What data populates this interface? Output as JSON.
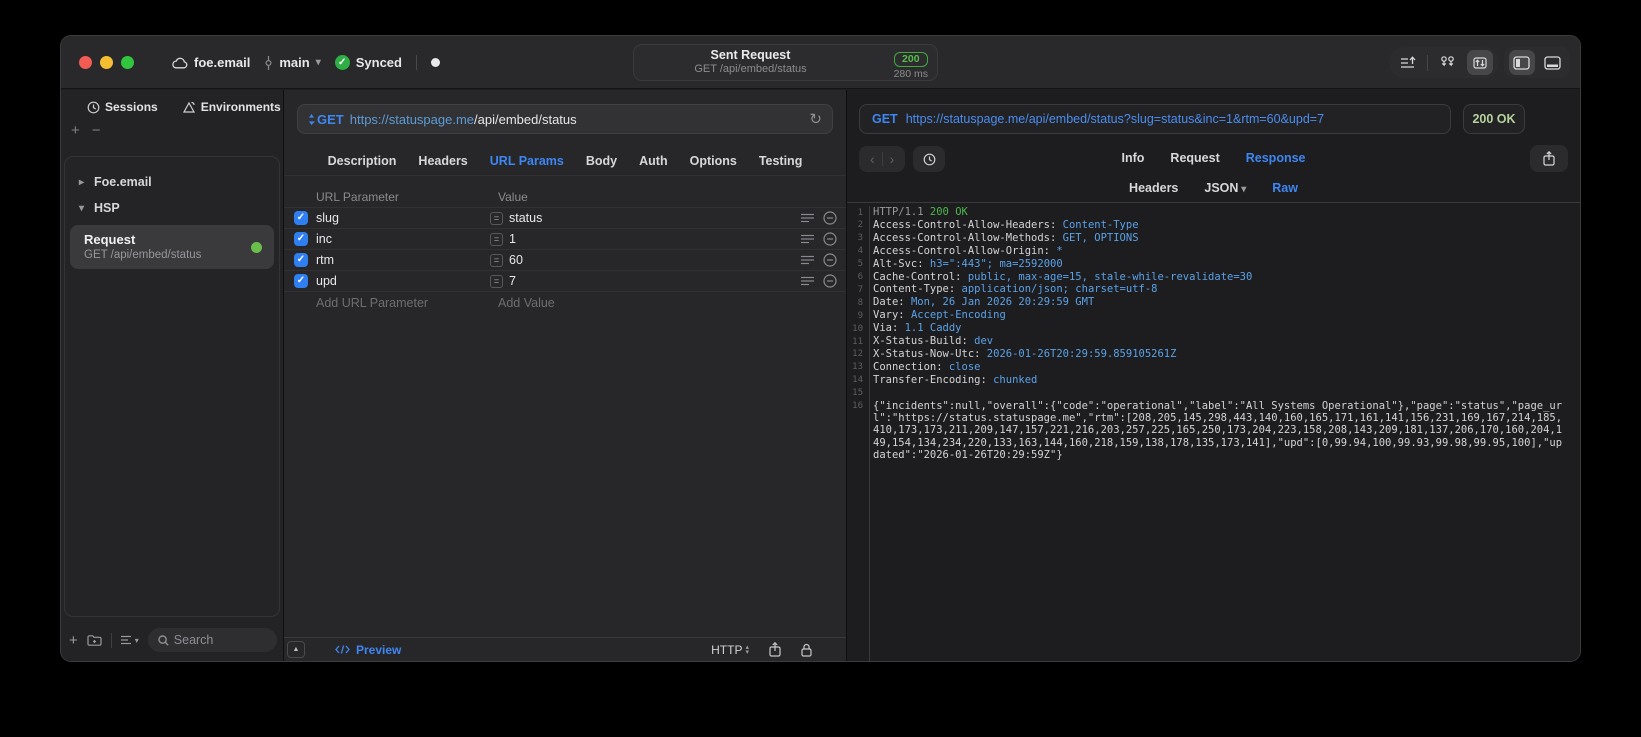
{
  "colors": {
    "accent_blue": "#3e86f2",
    "code_blue": "#5aa2e8",
    "status_green": "#4cb64c",
    "dot_green": "#6abf4b",
    "pale_green": "#b5d29c"
  },
  "titlebar": {
    "project": "foe.email",
    "branch": "main",
    "sync_label": "Synced",
    "center": {
      "title": "Sent Request",
      "subtitle": "GET /api/embed/status",
      "status_code": "200",
      "duration": "280 ms"
    }
  },
  "sidebar": {
    "tabs": [
      {
        "label": "Sessions",
        "icon": "clock-icon"
      },
      {
        "label": "Environments",
        "icon": "environments-icon"
      }
    ],
    "groups": [
      {
        "label": "Foe.email",
        "state": "collapsed"
      },
      {
        "label": "HSP",
        "state": "expanded"
      }
    ],
    "request_item": {
      "title": "Request",
      "subtitle": "GET /api/embed/status"
    },
    "search_placeholder": "Search"
  },
  "request_editor": {
    "method": "GET",
    "url_host": "https://statuspage.me",
    "url_path": "/api/embed/status",
    "tabs": [
      "Description",
      "Headers",
      "URL Params",
      "Body",
      "Auth",
      "Options",
      "Testing"
    ],
    "active_tab": "URL Params",
    "table": {
      "col_param": "URL Parameter",
      "col_value": "Value",
      "eq_symbol": "=",
      "rows": [
        {
          "enabled": true,
          "name": "slug",
          "value": "status"
        },
        {
          "enabled": true,
          "name": "inc",
          "value": "1"
        },
        {
          "enabled": true,
          "name": "rtm",
          "value": "60"
        },
        {
          "enabled": true,
          "name": "upd",
          "value": "7"
        }
      ],
      "add_param_placeholder": "Add URL Parameter",
      "add_value_placeholder": "Add Value"
    },
    "footer": {
      "preview_label": "Preview",
      "protocol_label": "HTTP"
    }
  },
  "response_viewer": {
    "method": "GET",
    "url": "https://statuspage.me/api/embed/status?slug=status&inc=1&rtm=60&upd=7",
    "status": "200 OK",
    "tabs": [
      "Info",
      "Request",
      "Response"
    ],
    "active_tab": "Response",
    "view_tabs": [
      "Headers",
      "JSON",
      "Raw"
    ],
    "active_view_tab": "Raw",
    "raw_lines": [
      {
        "n": "1",
        "parts": [
          {
            "t": "HTTP/1.1 ",
            "c": "dim"
          },
          {
            "t": "200 OK",
            "c": "green"
          }
        ]
      },
      {
        "n": "2",
        "parts": [
          {
            "t": "Access-Control-Allow-Headers: ",
            "c": "key"
          },
          {
            "t": "Content-Type",
            "c": "val"
          }
        ]
      },
      {
        "n": "3",
        "parts": [
          {
            "t": "Access-Control-Allow-Methods: ",
            "c": "key"
          },
          {
            "t": "GET, OPTIONS",
            "c": "val"
          }
        ]
      },
      {
        "n": "4",
        "parts": [
          {
            "t": "Access-Control-Allow-Origin: ",
            "c": "key"
          },
          {
            "t": "*",
            "c": "val"
          }
        ]
      },
      {
        "n": "5",
        "parts": [
          {
            "t": "Alt-Svc: ",
            "c": "key"
          },
          {
            "t": "h3=\":443\"; ma=2592000",
            "c": "val"
          }
        ]
      },
      {
        "n": "6",
        "parts": [
          {
            "t": "Cache-Control: ",
            "c": "key"
          },
          {
            "t": "public, max-age=15, stale-while-revalidate=30",
            "c": "val"
          }
        ]
      },
      {
        "n": "7",
        "parts": [
          {
            "t": "Content-Type: ",
            "c": "key"
          },
          {
            "t": "application/json; charset=utf-8",
            "c": "val"
          }
        ]
      },
      {
        "n": "8",
        "parts": [
          {
            "t": "Date: ",
            "c": "key"
          },
          {
            "t": "Mon, 26 Jan 2026 20:29:59 GMT",
            "c": "val"
          }
        ]
      },
      {
        "n": "9",
        "parts": [
          {
            "t": "Vary: ",
            "c": "key"
          },
          {
            "t": "Accept-Encoding",
            "c": "val"
          }
        ]
      },
      {
        "n": "10",
        "parts": [
          {
            "t": "Via: ",
            "c": "key"
          },
          {
            "t": "1.1 Caddy",
            "c": "val"
          }
        ]
      },
      {
        "n": "11",
        "parts": [
          {
            "t": "X-Status-Build: ",
            "c": "key"
          },
          {
            "t": "dev",
            "c": "val"
          }
        ]
      },
      {
        "n": "12",
        "parts": [
          {
            "t": "X-Status-Now-Utc: ",
            "c": "key"
          },
          {
            "t": "2026-01-26T20:29:59.859105261Z",
            "c": "val"
          }
        ]
      },
      {
        "n": "13",
        "parts": [
          {
            "t": "Connection: ",
            "c": "key"
          },
          {
            "t": "close",
            "c": "val"
          }
        ]
      },
      {
        "n": "14",
        "parts": [
          {
            "t": "Transfer-Encoding: ",
            "c": "key"
          },
          {
            "t": "chunked",
            "c": "val"
          }
        ]
      },
      {
        "n": "15",
        "parts": []
      },
      {
        "n": "16",
        "parts": [
          {
            "t": "{\"incidents\":null,\"overall\":{\"code\":\"operational\",\"label\":\"All Systems Operational\"},\"page\":\"status\",\"page_url\":\"https://status.statuspage.me\",\"rtm\":[208,205,145,298,443,140,160,165,171,161,141,156,231,169,167,214,185,410,173,173,211,209,147,157,221,216,203,257,225,165,250,173,204,223,158,208,143,209,181,137,206,170,160,204,149,154,134,234,220,133,163,144,160,218,159,138,178,135,173,141],\"upd\":[0,99.94,100,99.93,99.98,99.95,100],\"updated\":\"2026-01-26T20:29:59Z\"}",
            "c": "body"
          }
        ]
      }
    ]
  }
}
